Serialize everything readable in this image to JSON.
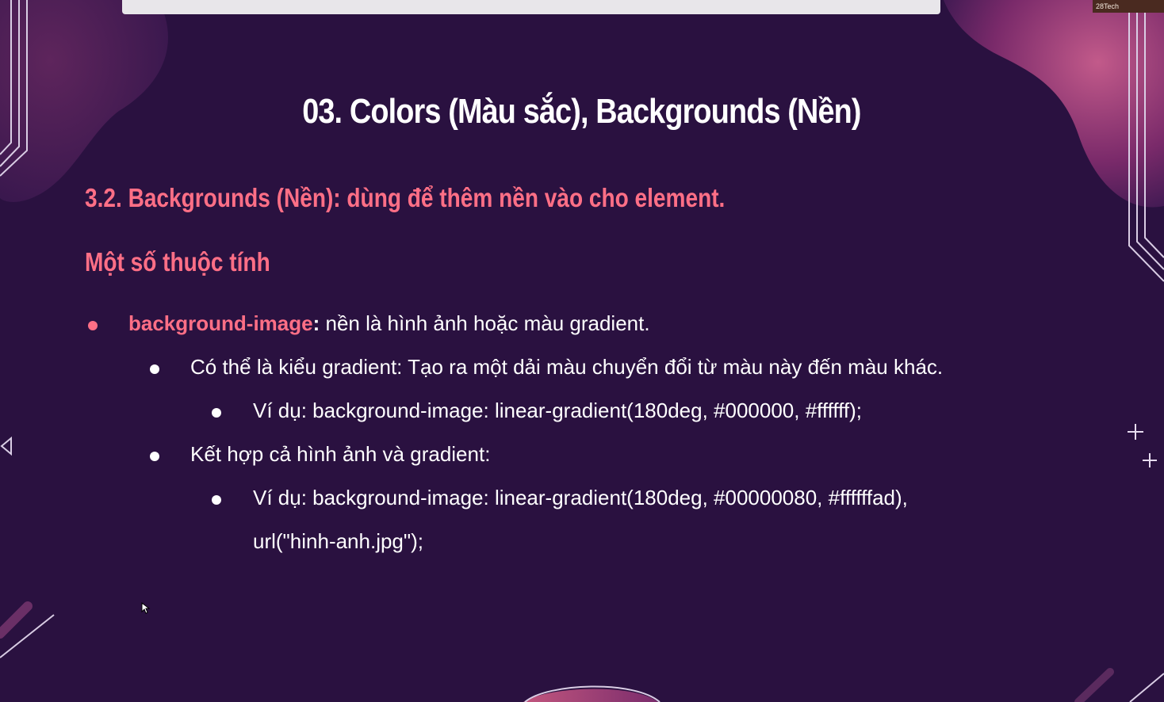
{
  "slide": {
    "title": "03. Colors (Màu sắc), Backgrounds (Nền)",
    "subtitle": "3.2. Backgrounds (Nền): dùng để thêm nền vào cho element.",
    "section_heading": "Một số thuộc tính",
    "bullet_main": {
      "property": "background-image",
      "separator": ":",
      "text": " nền là hình ảnh hoặc màu gradient."
    },
    "sub_bullet_1": "Có thể là kiểu gradient: Tạo ra một dải màu chuyển đổi từ màu này đến màu khác.",
    "example_1": "Ví dụ: background-image: linear-gradient(180deg, #000000, #ffffff);",
    "sub_bullet_2": "Kết hợp cả hình ảnh và gradient:",
    "example_2_line1": "Ví dụ: background-image: linear-gradient(180deg, #00000080, #ffffffad),",
    "example_2_line2": "url(\"hinh-anh.jpg\");",
    "camera_label": "28Tech"
  },
  "colors": {
    "background": "#2a1140",
    "accent": "#ff6f86",
    "text": "#ffffff"
  }
}
